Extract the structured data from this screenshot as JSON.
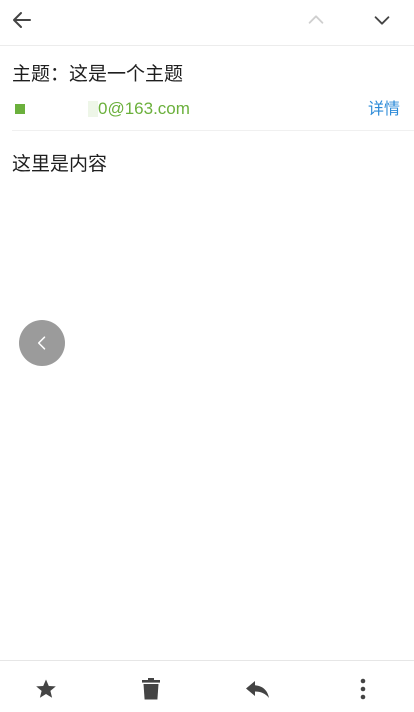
{
  "header": {
    "subject": "主题：这是一个主题",
    "sender_email": "0@163.com",
    "details_label": "详情"
  },
  "body": {
    "content": "这里是内容"
  },
  "icons": {
    "back": "arrow-left-icon",
    "prev": "chevron-up-icon",
    "next": "chevron-down-icon",
    "float_back": "chevron-left-icon",
    "star": "star-icon",
    "trash": "trash-icon",
    "reply": "reply-icon",
    "more": "more-vertical-icon"
  },
  "colors": {
    "sender_green": "#6bb03c",
    "link_blue": "#2e8bd8",
    "icon_dark": "#444444",
    "icon_disabled": "#cfcfcf",
    "float_bg": "#9b9b9b"
  }
}
